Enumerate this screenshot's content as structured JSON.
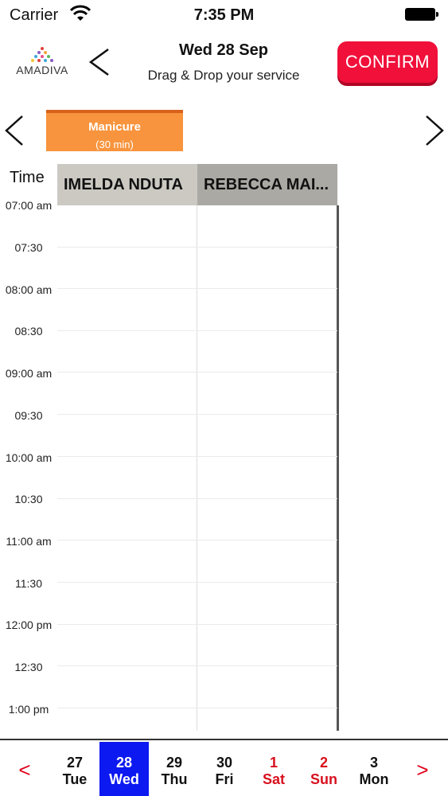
{
  "status_bar": {
    "carrier": "Carrier",
    "time": "7:35 PM"
  },
  "header": {
    "logo_text": "AMADIVA",
    "title": "Wed 28 Sep",
    "subtitle": "Drag & Drop your service",
    "confirm_label": "CONFIRM"
  },
  "service": {
    "name": "Manicure",
    "duration": "(30 min)"
  },
  "calendar": {
    "time_header": "Time",
    "staff": [
      "IMELDA NDUTA",
      "REBECCA MAI..."
    ],
    "slots": [
      "07:00 am",
      "07:30",
      "08:00 am",
      "08:30",
      "09:00 am",
      "09:30",
      "10:00 am",
      "10:30",
      "11:00 am",
      "11:30",
      "12:00 pm",
      "12:30",
      "1:00 pm"
    ]
  },
  "date_bar": {
    "prev_label": "<",
    "next_label": ">",
    "days": [
      {
        "num": "27",
        "name": "Tue"
      },
      {
        "num": "28",
        "name": "Wed"
      },
      {
        "num": "29",
        "name": "Thu"
      },
      {
        "num": "30",
        "name": "Fri"
      },
      {
        "num": "1",
        "name": "Sat"
      },
      {
        "num": "2",
        "name": "Sun"
      },
      {
        "num": "3",
        "name": "Mon"
      }
    ]
  },
  "colors": {
    "confirm": "#f0103a",
    "service_card": "#f7943d",
    "selected_day": "#0c19f0",
    "weekend": "#d8101e"
  }
}
